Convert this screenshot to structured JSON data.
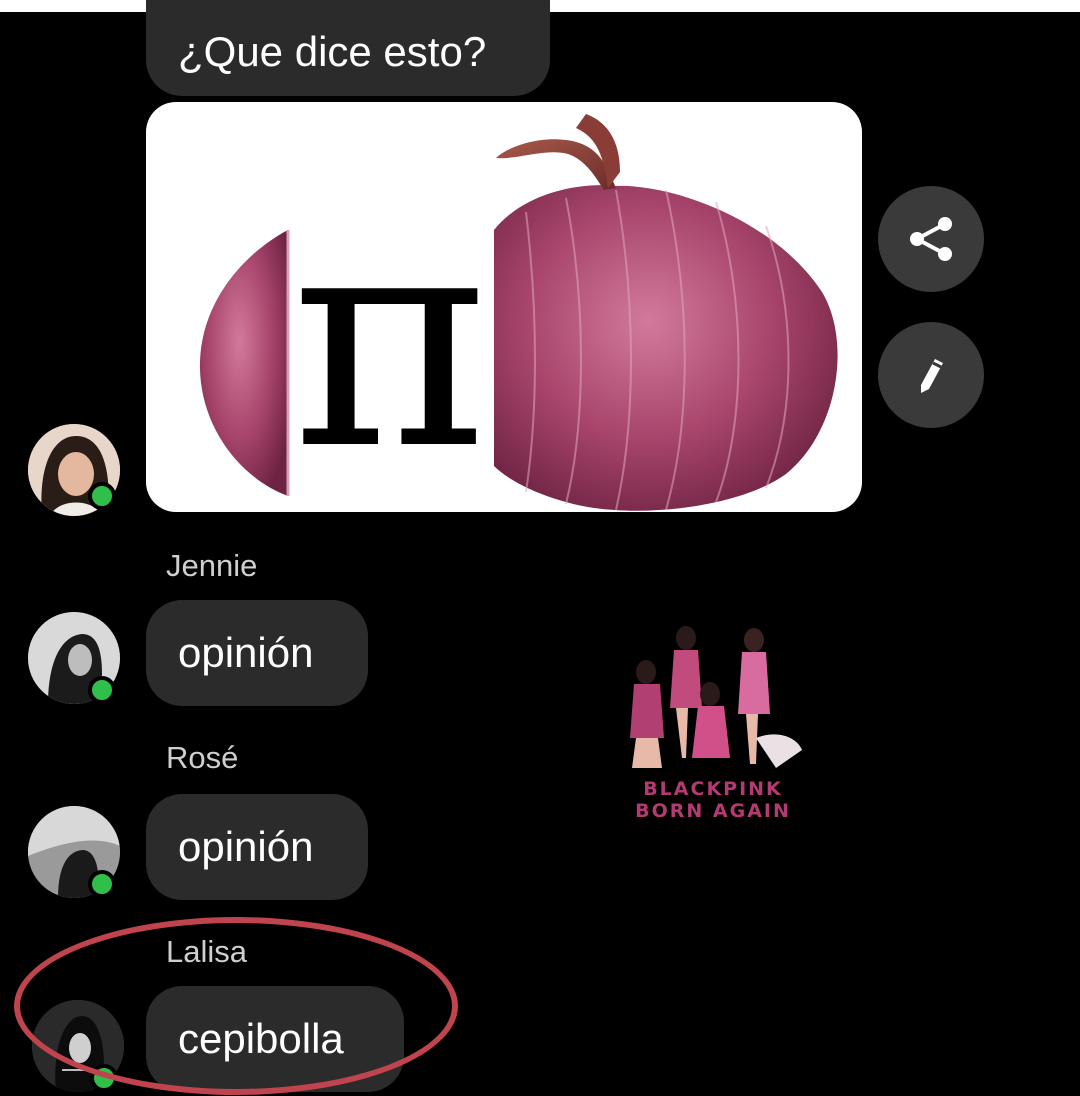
{
  "messages": [
    {
      "type": "text",
      "text": "¿Que dice esto?"
    },
    {
      "type": "image",
      "symbol": "π"
    },
    {
      "sender": "Jennie",
      "text": "opinión"
    },
    {
      "sender": "Rosé",
      "text": "opinión"
    },
    {
      "sender": "Lalisa",
      "text": "cepibolla"
    }
  ],
  "actions": {
    "share_icon": "share-icon",
    "edit_icon": "pencil-icon"
  },
  "sticker": {
    "line1": "BLACKPINK",
    "line2": "BORN AGAIN"
  },
  "colors": {
    "background": "#000000",
    "bubble": "#2b2b2b",
    "online": "#2fbf4a",
    "highlight": "#c0444d"
  }
}
